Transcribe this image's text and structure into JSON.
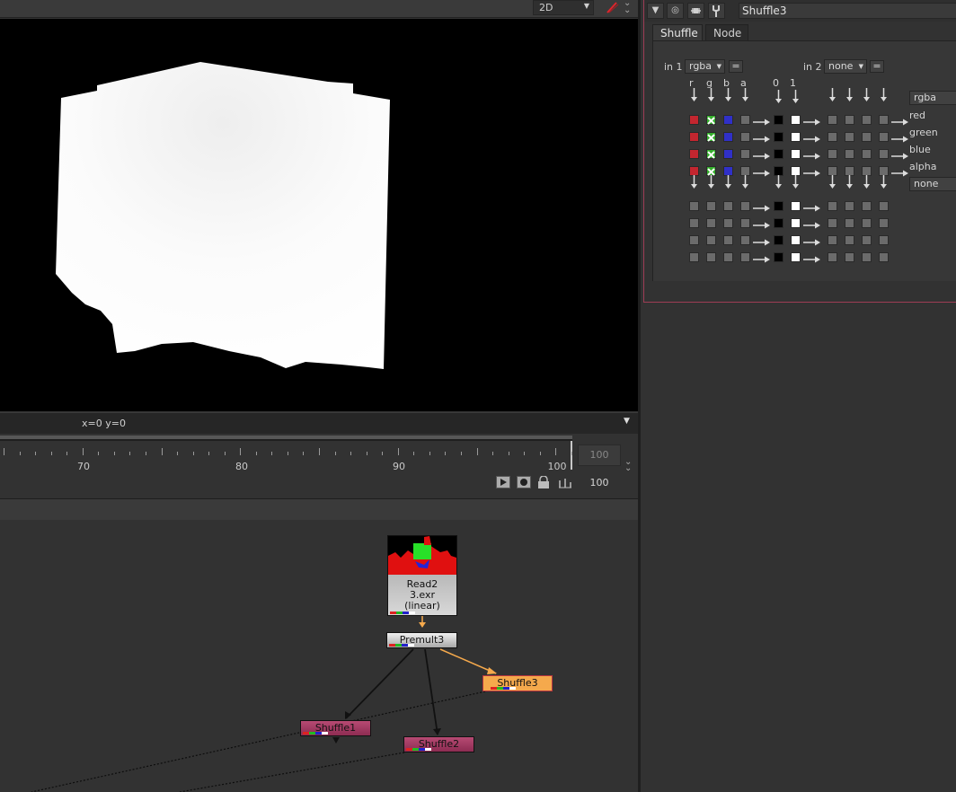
{
  "viewer": {
    "view_mode": "2D",
    "coords": "x=0 y=0"
  },
  "timeline": {
    "ticks": [
      {
        "label": "70"
      },
      {
        "label": "80"
      },
      {
        "label": "90"
      },
      {
        "label": "100"
      }
    ],
    "end_frame": "100",
    "current_frame": "100"
  },
  "dag": {
    "nodes": {
      "read": {
        "name": "Read2",
        "file": "3.exr",
        "colorspace": "(linear)"
      },
      "premult": {
        "name": "Premult3"
      },
      "shuffle3": {
        "name": "Shuffle3"
      },
      "shuffle1": {
        "name": "Shuffle1"
      },
      "shuffle2": {
        "name": "Shuffle2"
      }
    }
  },
  "properties": {
    "node_name": "Shuffle3",
    "tabs": {
      "shuffle": "Shuffle",
      "node": "Node"
    },
    "in1": {
      "label": "in 1",
      "value": "rgba"
    },
    "in2": {
      "label": "in 2",
      "value": "none"
    },
    "eq_label": "=",
    "channel_headers": [
      "r",
      "g",
      "b",
      "a"
    ],
    "const_headers": [
      "0",
      "1"
    ],
    "out1": {
      "value": "rgba",
      "channels": [
        "red",
        "green",
        "blue",
        "alpha"
      ]
    },
    "out2": {
      "value": "none"
    }
  },
  "colors": {
    "accent_orange": "#f5a94c",
    "node_pink": "#a3395f",
    "red_chip": "#c3262f",
    "green_chip": "#36b02d",
    "blue_chip": "#3030c8",
    "panel_border": "#9e3d55"
  }
}
